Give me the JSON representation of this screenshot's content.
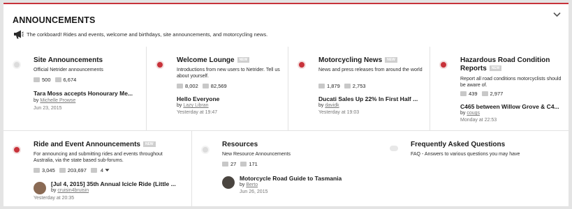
{
  "category": {
    "title": "ANNOUNCEMENTS",
    "description": "The corkboard! Rides and events, welcome and birthdays, site announcements, and motorcycling news."
  },
  "badge_new": "NEW",
  "nodes": [
    {
      "title": "Site Announcements",
      "description": "Official Netrider announcements",
      "threads": "500",
      "messages": "6,674",
      "latest_title": "Tara Moss accepts Honourary Me...",
      "latest_by": "by",
      "latest_user": "Michelle Prowse",
      "latest_date": "Jun 23, 2015",
      "status": "read"
    },
    {
      "title": "Welcome Lounge",
      "description": "Introductions from new users to Netrider. Tell us about yourself.",
      "threads": "8,002",
      "messages": "82,569",
      "latest_title": "Hello Everyone",
      "latest_by": "by",
      "latest_user": "Lazy Libran",
      "latest_date": "Yesterday at 19:47",
      "status": "unread"
    },
    {
      "title": "Motorcycling News",
      "description": "News and press releases from around the world",
      "threads": "1,879",
      "messages": "2,753",
      "latest_title": "Ducati Sales Up 22% In First Half ...",
      "latest_by": "by",
      "latest_user": "davidk",
      "latest_date": "Yesterday at 19:03",
      "status": "unread"
    },
    {
      "title_line1": "Hazardous Road Condition",
      "title_line2": "Reports",
      "description": "Report all road conditions motorcyclists should be aware of.",
      "threads": "439",
      "messages": "2,977",
      "latest_title": "C465 between Willow Grove & C4...",
      "latest_by": "by",
      "latest_user": "cougs",
      "latest_date": "Monday at 22:53",
      "status": "unread"
    },
    {
      "title": "Ride and Event Announcements",
      "description": "For announcing and submitting rides and events throughout Australia, via the state based sub-forums.",
      "threads": "3,045",
      "messages": "203,697",
      "subforums": "4",
      "latest_title": "[Jul 4, 2015] 35th Annual Icicle Ride (Little ...",
      "latest_by": "by",
      "latest_user": "cruisin4bruisin",
      "latest_date": "Yesterday at 20:35",
      "status": "unread"
    },
    {
      "title": "Resources",
      "description": "New Resource Announcements",
      "threads": "27",
      "messages": "171",
      "latest_title": "Motorcycle Road Guide to Tasmania",
      "latest_by": "by",
      "latest_user": "Berto",
      "latest_date": "Jun 26, 2015",
      "status": "read"
    },
    {
      "title": "Frequently Asked Questions",
      "description": "FAQ - Answers to various questions you may have",
      "status": "link"
    }
  ],
  "icons": {
    "collapse": "chevron-down-icon",
    "megaphone": "megaphone-icon",
    "threads": "discussions-icon",
    "messages": "messages-icon"
  },
  "colors": {
    "accent": "#c8323a",
    "muted_link": "#777777"
  }
}
